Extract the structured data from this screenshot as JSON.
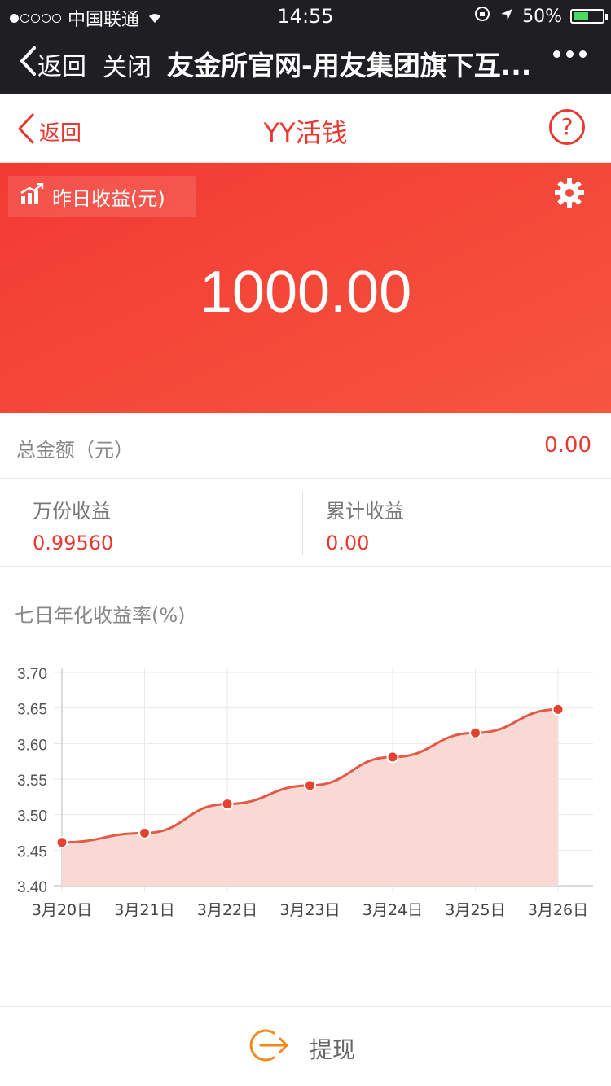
{
  "status_bar": {
    "carrier": "中国联通",
    "time": "14:55",
    "battery": "50%"
  },
  "wechat_bar": {
    "back_label": "返回",
    "close_label": "关闭",
    "title": "友金所官网-用友集团旗下互..."
  },
  "header": {
    "back_label": "返回",
    "title": "YY活钱",
    "help_symbol": "?"
  },
  "banner": {
    "label": "昨日收益(元)",
    "amount": "1000.00"
  },
  "total": {
    "label": "总金额（元）",
    "value": "0.00"
  },
  "metrics": [
    {
      "label": "万份收益",
      "value": "0.99560"
    },
    {
      "label": "累计收益",
      "value": "0.00"
    }
  ],
  "chart_title": "七日年化收益率(%)",
  "chart_data": {
    "type": "area",
    "categories": [
      "3月20日",
      "3月21日",
      "3月22日",
      "3月23日",
      "3月24日",
      "3月25日",
      "3月26日"
    ],
    "series": [
      {
        "values": [
          3.461,
          3.474,
          3.515,
          3.541,
          3.581,
          3.615,
          3.648
        ]
      }
    ],
    "ylim": [
      3.4,
      3.7
    ],
    "yticks": [
      "3.40",
      "3.45",
      "3.50",
      "3.55",
      "3.60",
      "3.65",
      "3.70"
    ],
    "grid": true,
    "line_color": "#e35a47",
    "fill_color": "#f8d9d4"
  },
  "bottom": {
    "withdraw_label": "提现"
  },
  "colors": {
    "accent": "#e8382f",
    "banner": "#f23a33",
    "withdraw_icon": "#f08a1a"
  }
}
